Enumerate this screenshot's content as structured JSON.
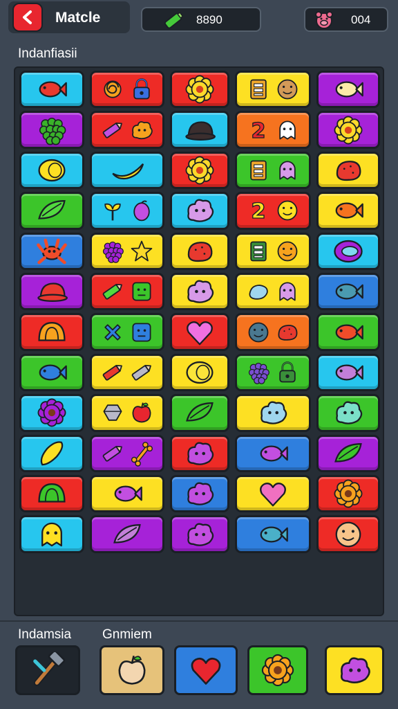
{
  "header": {
    "title": "Matcle",
    "coins": "8890",
    "lives": "004"
  },
  "board_label": "Indanfiasii",
  "bottom_labels": [
    "Indamsia",
    "Gnmiem"
  ],
  "colors": {
    "cyan": "#27c6ee",
    "red": "#ee2b26",
    "yellow": "#fde023",
    "purple": "#a622d8",
    "green": "#3cc52a",
    "orange": "#f6731f",
    "blue": "#2f7fde"
  },
  "grid": [
    [
      {
        "bg": "cyan",
        "icons": [
          {
            "name": "fish-icon",
            "fill": "#e8392f"
          }
        ]
      },
      {
        "bg": "red",
        "icons": [
          {
            "name": "swirl-icon",
            "fill": "#f6a21e"
          },
          {
            "name": "padlock-icon",
            "fill": "#3a6fe0"
          }
        ]
      },
      {
        "bg": "red",
        "icons": [
          {
            "name": "sun-icon",
            "fill": "#fbd92b"
          }
        ]
      },
      {
        "bg": "yellow",
        "icons": [
          {
            "name": "card-icon",
            "fill": "#f0a82c"
          },
          {
            "name": "cookie-icon",
            "fill": "#d39a58"
          }
        ]
      },
      {
        "bg": "purple",
        "icons": [
          {
            "name": "fish-icon",
            "fill": "#fbe9a8"
          }
        ]
      }
    ],
    [
      {
        "bg": "purple",
        "icons": [
          {
            "name": "grapes-icon",
            "fill": "#3ab32a"
          }
        ]
      },
      {
        "bg": "red",
        "icons": [
          {
            "name": "crayon-icon",
            "fill": "#c24fe0"
          },
          {
            "name": "blob-icon",
            "fill": "#f6a21e"
          }
        ]
      },
      {
        "bg": "cyan",
        "icons": [
          {
            "name": "hat-icon",
            "fill": "#3b2e2e"
          }
        ]
      },
      {
        "bg": "orange",
        "icons": [
          {
            "name": "number-two-icon",
            "fill": "#e8262f"
          },
          {
            "name": "ghost-icon",
            "fill": "#ffffff"
          }
        ]
      },
      {
        "bg": "purple",
        "icons": [
          {
            "name": "sun-icon",
            "fill": "#fbd92b"
          }
        ]
      }
    ],
    [
      {
        "bg": "cyan",
        "icons": [
          {
            "name": "lemon-icon",
            "fill": "#fde023"
          }
        ]
      },
      {
        "bg": "cyan",
        "icons": [
          {
            "name": "banana-icon",
            "fill": "#fde023"
          }
        ]
      },
      {
        "bg": "red",
        "icons": [
          {
            "name": "sun-icon",
            "fill": "#fbd92b"
          }
        ]
      },
      {
        "bg": "green",
        "icons": [
          {
            "name": "card-icon",
            "fill": "#f0a82c"
          },
          {
            "name": "pig-icon",
            "fill": "#d79ae8"
          }
        ]
      },
      {
        "bg": "yellow",
        "icons": [
          {
            "name": "berry-icon",
            "fill": "#e8392f"
          }
        ]
      }
    ],
    [
      {
        "bg": "green",
        "icons": [
          {
            "name": "leaf-icon",
            "fill": "#52d93f"
          }
        ]
      },
      {
        "bg": "cyan",
        "icons": [
          {
            "name": "sprout-icon",
            "fill": "#fde023"
          },
          {
            "name": "plum-icon",
            "fill": "#c24fe0"
          }
        ]
      },
      {
        "bg": "cyan",
        "icons": [
          {
            "name": "cloud-icon",
            "fill": "#d79ae8"
          }
        ]
      },
      {
        "bg": "red",
        "icons": [
          {
            "name": "number-two-icon",
            "fill": "#fde023"
          },
          {
            "name": "smiley-icon",
            "fill": "#fde023"
          }
        ]
      },
      {
        "bg": "yellow",
        "icons": [
          {
            "name": "fish-icon",
            "fill": "#f6731f"
          }
        ]
      }
    ],
    [
      {
        "bg": "blue",
        "icons": [
          {
            "name": "crab-icon",
            "fill": "#f04c2a"
          }
        ]
      },
      {
        "bg": "yellow",
        "icons": [
          {
            "name": "grapes-icon",
            "fill": "#a622d8"
          },
          {
            "name": "star-icon",
            "fill": "#fbd92b"
          }
        ]
      },
      {
        "bg": "yellow",
        "icons": [
          {
            "name": "bean-icon",
            "fill": "#e8392f"
          }
        ]
      },
      {
        "bg": "yellow",
        "icons": [
          {
            "name": "card-icon",
            "fill": "#3a8f3a"
          },
          {
            "name": "orange-fruit-icon",
            "fill": "#f6a21e"
          }
        ]
      },
      {
        "bg": "cyan",
        "icons": [
          {
            "name": "ring-icon",
            "fill": "#a622d8"
          }
        ]
      }
    ],
    [
      {
        "bg": "purple",
        "icons": [
          {
            "name": "hat-icon",
            "fill": "#e8392f"
          }
        ]
      },
      {
        "bg": "red",
        "icons": [
          {
            "name": "crayon-icon",
            "fill": "#52d93f"
          },
          {
            "name": "cube-icon",
            "fill": "#3cc52a"
          }
        ]
      },
      {
        "bg": "yellow",
        "icons": [
          {
            "name": "cloud-icon",
            "fill": "#d79ae8"
          }
        ]
      },
      {
        "bg": "yellow",
        "icons": [
          {
            "name": "drop-icon",
            "fill": "#9fd6ee"
          },
          {
            "name": "pig-icon",
            "fill": "#d79ae8"
          }
        ]
      },
      {
        "bg": "blue",
        "icons": [
          {
            "name": "fish-icon",
            "fill": "#4a9ab0"
          }
        ]
      }
    ],
    [
      {
        "bg": "red",
        "icons": [
          {
            "name": "taco-icon",
            "fill": "#f6a21e"
          }
        ]
      },
      {
        "bg": "green",
        "icons": [
          {
            "name": "cross-icon",
            "fill": "#2f7fde"
          },
          {
            "name": "box-icon",
            "fill": "#2f7fde"
          }
        ]
      },
      {
        "bg": "red",
        "icons": [
          {
            "name": "heart-icon",
            "fill": "#f070e0"
          }
        ]
      },
      {
        "bg": "orange",
        "icons": [
          {
            "name": "ball-icon",
            "fill": "#4a7890"
          },
          {
            "name": "shell-icon",
            "fill": "#e8392f"
          }
        ]
      },
      {
        "bg": "green",
        "icons": [
          {
            "name": "fish-icon",
            "fill": "#f04c2a"
          }
        ]
      }
    ],
    [
      {
        "bg": "green",
        "icons": [
          {
            "name": "fish-icon",
            "fill": "#2f7fde"
          }
        ]
      },
      {
        "bg": "yellow",
        "icons": [
          {
            "name": "crayon-icon",
            "fill": "#e8392f"
          },
          {
            "name": "crayon-icon",
            "fill": "#b8b8c8"
          }
        ]
      },
      {
        "bg": "yellow",
        "icons": [
          {
            "name": "lemon-icon",
            "fill": "#fbe43a"
          }
        ]
      },
      {
        "bg": "green",
        "icons": [
          {
            "name": "grapes-icon",
            "fill": "#7a4fd0"
          },
          {
            "name": "padlock-icon",
            "fill": "#3a8f3a"
          }
        ]
      },
      {
        "bg": "cyan",
        "icons": [
          {
            "name": "fish-icon",
            "fill": "#c27fd8"
          }
        ]
      }
    ],
    [
      {
        "bg": "cyan",
        "icons": [
          {
            "name": "flower-icon",
            "fill": "#a622d8"
          }
        ]
      },
      {
        "bg": "yellow",
        "icons": [
          {
            "name": "gem-icon",
            "fill": "#b8b8c8"
          },
          {
            "name": "apple-icon",
            "fill": "#e8262f"
          }
        ]
      },
      {
        "bg": "green",
        "icons": [
          {
            "name": "leaf-icon",
            "fill": "#3cc52a"
          }
        ]
      },
      {
        "bg": "yellow",
        "icons": [
          {
            "name": "cloud-icon",
            "fill": "#9fd6ee"
          }
        ]
      },
      {
        "bg": "green",
        "icons": [
          {
            "name": "cloud-icon",
            "fill": "#7be0c8"
          }
        ]
      }
    ],
    [
      {
        "bg": "cyan",
        "icons": [
          {
            "name": "corn-icon",
            "fill": "#fde023"
          }
        ]
      },
      {
        "bg": "purple",
        "icons": [
          {
            "name": "crayon-icon",
            "fill": "#c24fe0"
          },
          {
            "name": "bone-icon",
            "fill": "#f6a21e"
          }
        ]
      },
      {
        "bg": "red",
        "icons": [
          {
            "name": "cloud-icon",
            "fill": "#c24fe0"
          }
        ]
      },
      {
        "bg": "blue",
        "icons": [
          {
            "name": "fish-icon",
            "fill": "#c24fe0"
          }
        ]
      },
      {
        "bg": "purple",
        "icons": [
          {
            "name": "pea-pod-icon",
            "fill": "#3cc52a"
          }
        ]
      }
    ],
    [
      {
        "bg": "red",
        "icons": [
          {
            "name": "watermelon-icon",
            "fill": "#3cc52a"
          }
        ]
      },
      {
        "bg": "yellow",
        "icons": [
          {
            "name": "fish-icon",
            "fill": "#c24fe0"
          }
        ]
      },
      {
        "bg": "blue",
        "icons": [
          {
            "name": "cloud-icon",
            "fill": "#c24fe0"
          }
        ]
      },
      {
        "bg": "yellow",
        "icons": [
          {
            "name": "heart-icon",
            "fill": "#f070c0"
          }
        ]
      },
      {
        "bg": "red",
        "icons": [
          {
            "name": "flower-icon",
            "fill": "#f6a21e"
          }
        ]
      }
    ],
    [
      {
        "bg": "cyan",
        "icons": [
          {
            "name": "duck-icon",
            "fill": "#fde023"
          }
        ]
      },
      {
        "bg": "purple",
        "icons": [
          {
            "name": "leaf-icon",
            "fill": "#c27fd8"
          }
        ]
      },
      {
        "bg": "purple",
        "icons": [
          {
            "name": "monster-icon",
            "fill": "#c24fe0"
          }
        ]
      },
      {
        "bg": "blue",
        "icons": [
          {
            "name": "fish-icon",
            "fill": "#4ab0c8"
          }
        ]
      },
      {
        "bg": "red",
        "icons": [
          {
            "name": "smiley-icon",
            "fill": "#f7c48a"
          }
        ]
      }
    ]
  ],
  "inventory": [
    {
      "bg": "#1f252c",
      "icon": {
        "name": "hammer-icon",
        "fill": "#c07a3a"
      }
    },
    {
      "bg": "#e6c27a",
      "icon": {
        "name": "strawberry-icon",
        "fill": "#f3d6b0"
      }
    },
    {
      "bg": "blue",
      "icon": {
        "name": "heart-icon",
        "fill": "#e8262f"
      }
    },
    {
      "bg": "green",
      "icon": {
        "name": "flower-icon",
        "fill": "#f6a21e"
      }
    },
    {
      "bg": "yellow",
      "icon": {
        "name": "cloud-icon",
        "fill": "#c24fe0"
      }
    }
  ]
}
